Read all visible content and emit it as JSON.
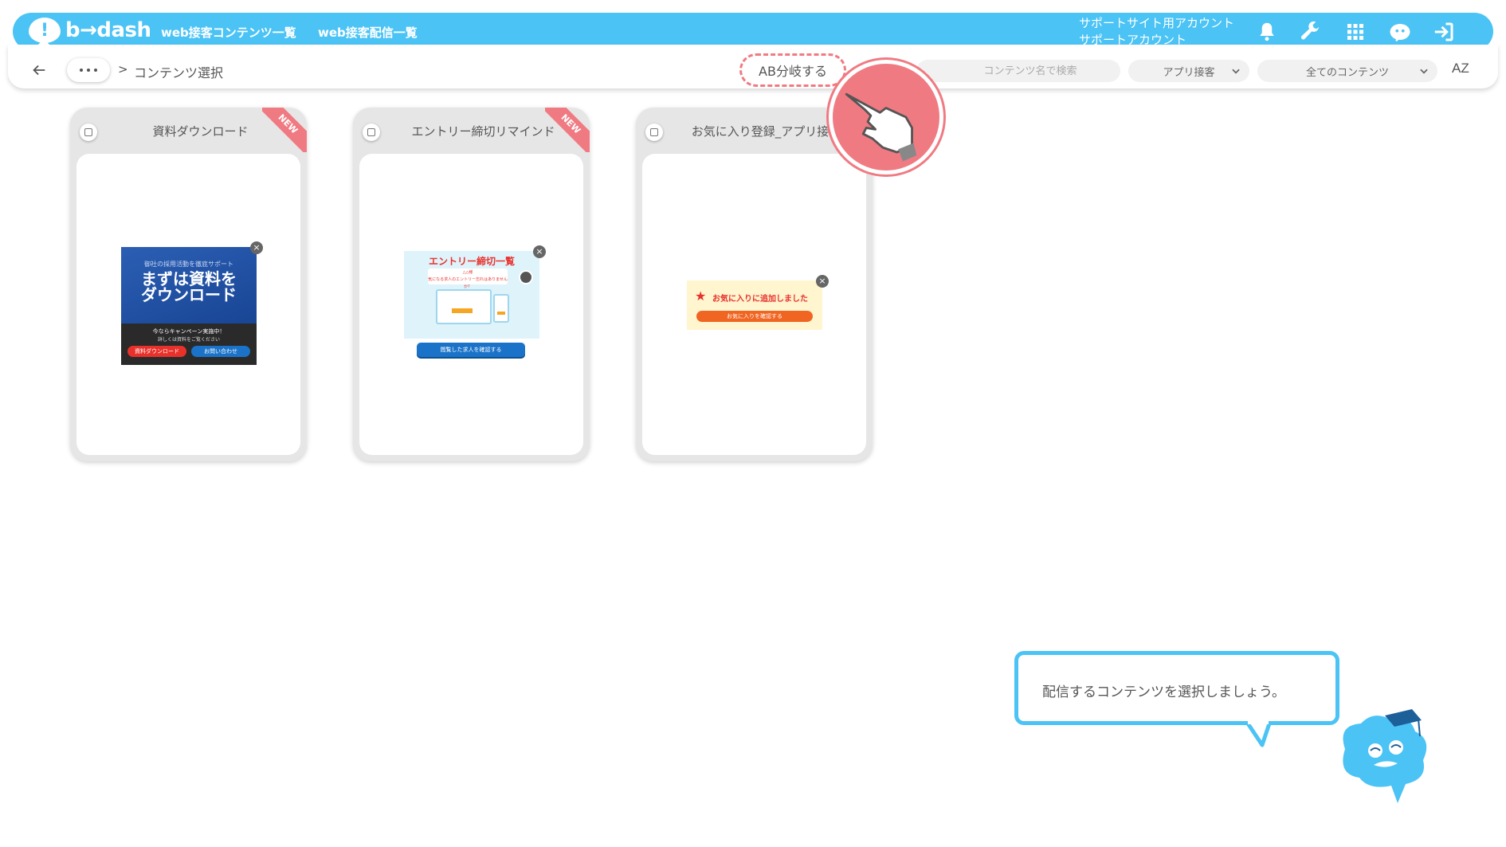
{
  "header": {
    "logo_text": "b→dash",
    "nav": [
      "web接客コンテンツ一覧",
      "web接客配信一覧"
    ],
    "account_line1": "サポートサイト用アカウント",
    "account_line2": "サポートアカウント",
    "icons": [
      "bell-icon",
      "wrench-icon",
      "grid-icon",
      "robot-icon",
      "logout-icon"
    ],
    "color": "#4bc3f5"
  },
  "breadcrumb": {
    "separator": ">",
    "current": "コンテンツ選択"
  },
  "toolbar": {
    "ab_button": "AB分岐する",
    "search_placeholder": "コンテンツ名で検索",
    "channel_select": "アプリ接客",
    "content_select": "全てのコンテンツ",
    "sort_label": "AZ"
  },
  "cards": [
    {
      "title": "資料ダウンロード",
      "new_badge": "NEW",
      "thumb": {
        "small": "御社の採用活動を徹底サポート",
        "headline1": "まずは資料を",
        "headline2": "ダウンロード",
        "sub1": "今ならキャンペーン実施中！",
        "sub2": "詳しくは資料をご覧ください",
        "btn1": "資料ダウンロード",
        "btn2": "お問い合わせ"
      }
    },
    {
      "title": "エントリー締切リマインド",
      "new_badge": "NEW",
      "thumb": {
        "headline": "エントリー締切一覧",
        "small1": "△△様",
        "small2": "気になる求人のエントリー忘れはありませんか？",
        "btn": "閲覧した求人を確認する"
      }
    },
    {
      "title": "お気に入り登録_アプリ接客",
      "new_badge": "",
      "thumb": {
        "headline": "お気に入りに追加しました",
        "btn": "お気に入りを確認する"
      }
    }
  ],
  "tip": {
    "text": "配信するコンテンツを選択しましょう。"
  }
}
